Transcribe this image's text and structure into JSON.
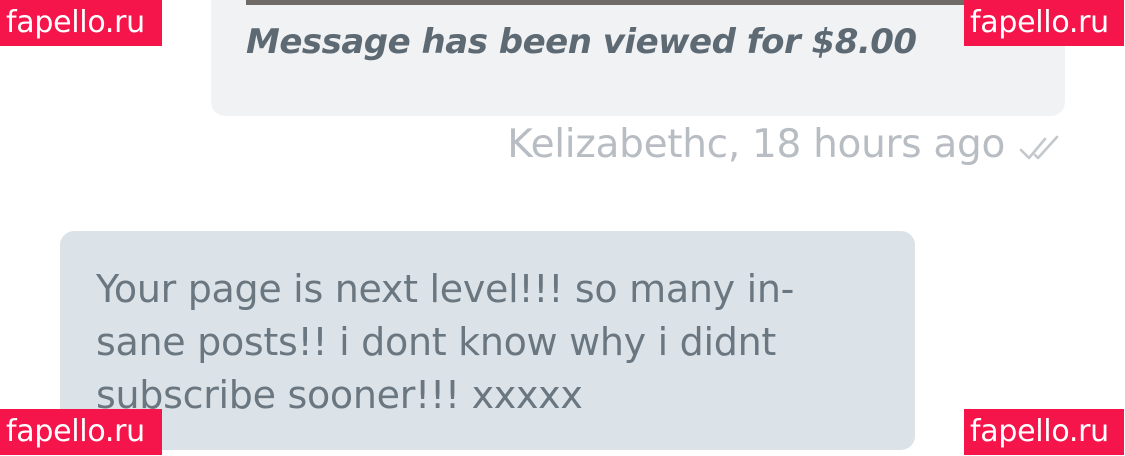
{
  "outgoing_message": {
    "viewed_text": "Message has been viewed for $8.00"
  },
  "meta": {
    "sender_time": "Kelizabethc, 18 hours ago",
    "status_icon": "double-check-icon"
  },
  "incoming_message": {
    "lines": [
      "Your page is next level!!! so many in-",
      "sane posts!! i dont know why i didnt",
      "subscribe sooner!!! xxxxx"
    ]
  },
  "watermarks": {
    "top_left": "fapello.ru",
    "top_right": "fapello.ru",
    "bottom_left": "fapello.ru",
    "bottom_right": "fapello.ru"
  },
  "colors": {
    "watermark_bg": "#f5154a",
    "outgoing_bubble": "#f1f2f4",
    "incoming_bubble": "#dce3e8",
    "meta_text": "#b7bdc2"
  }
}
